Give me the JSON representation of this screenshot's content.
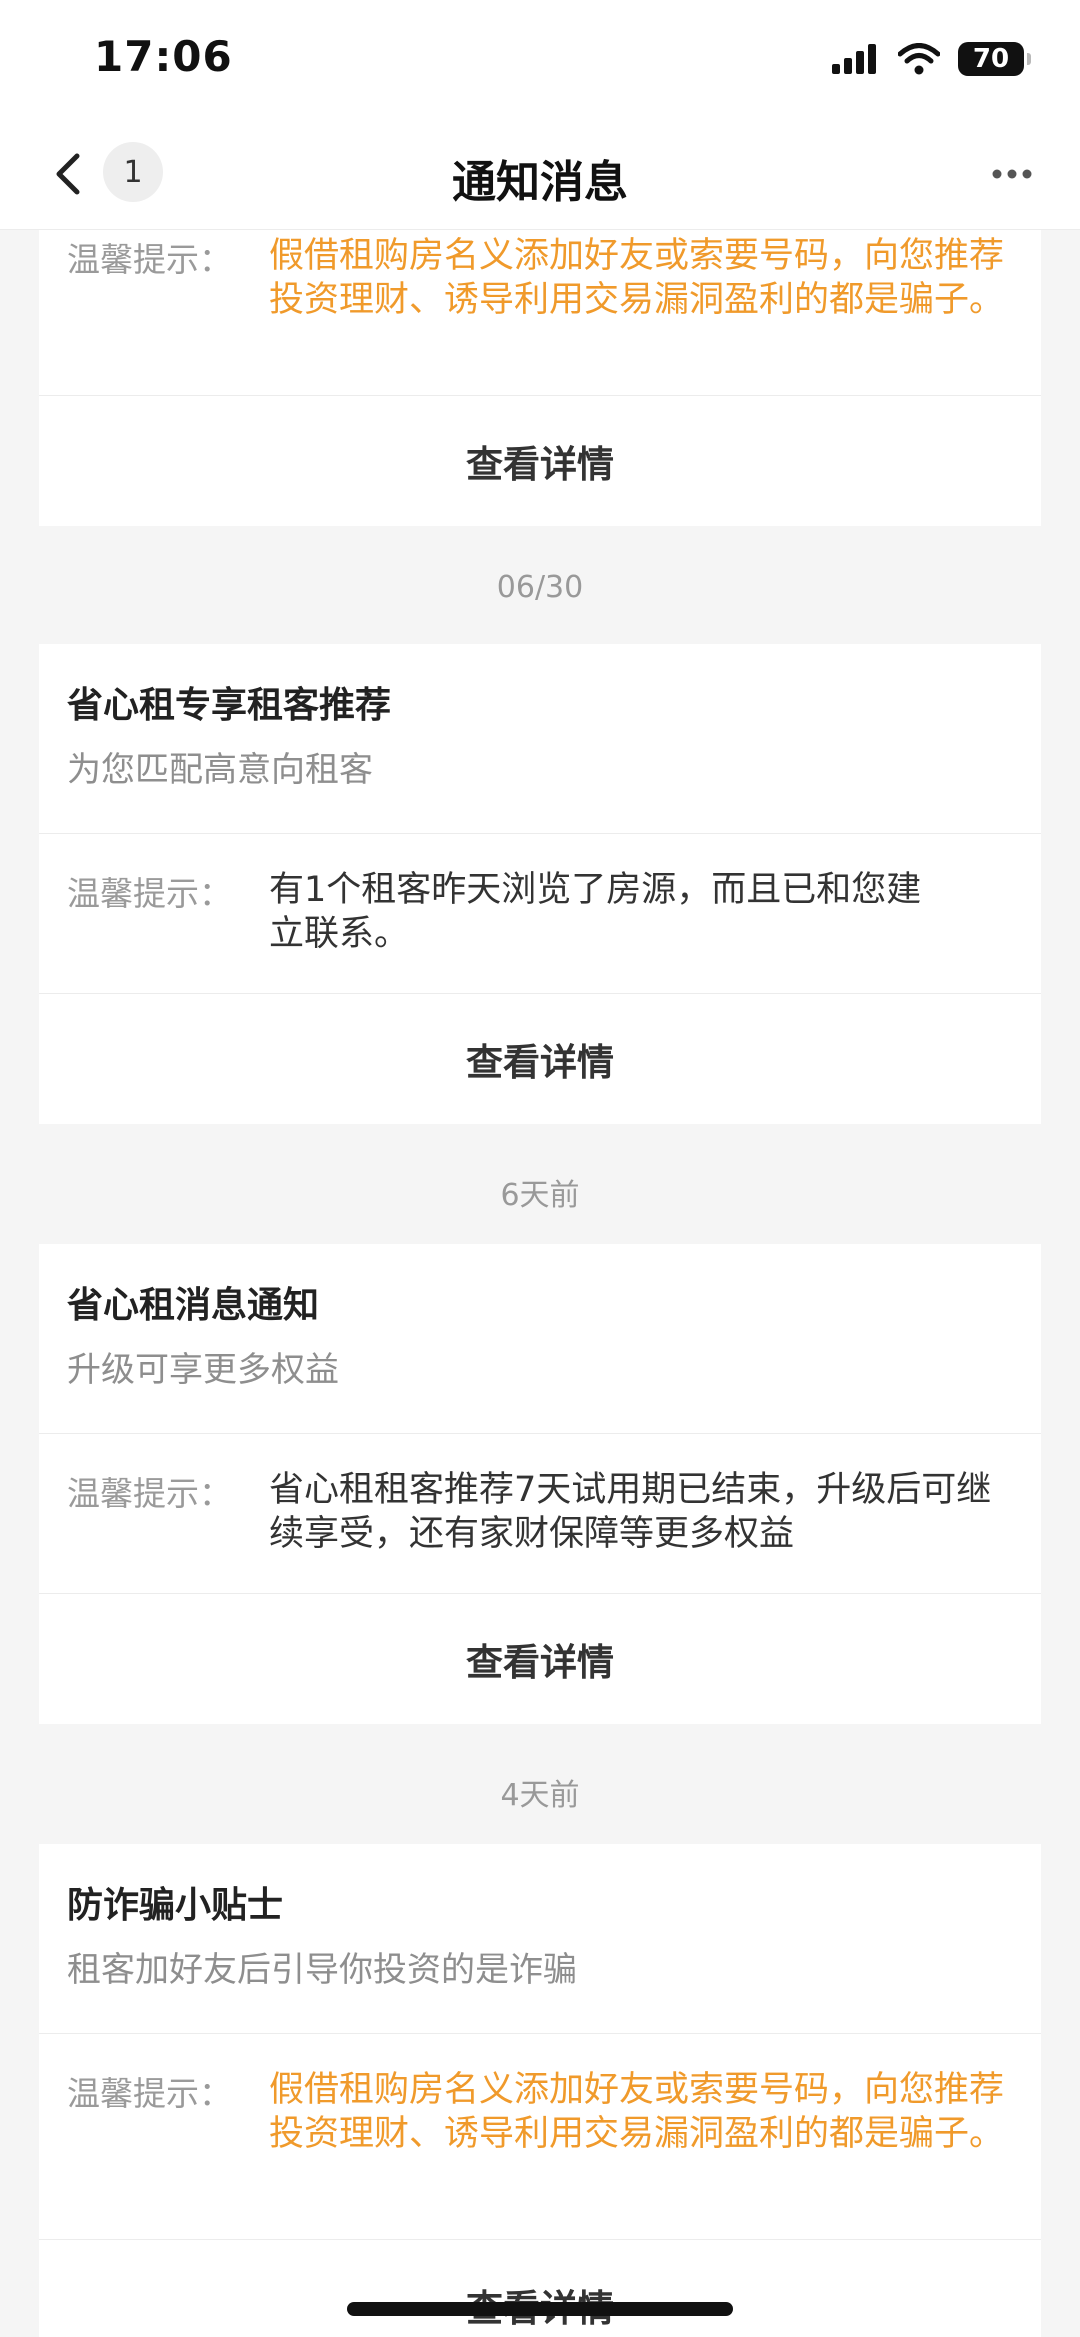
{
  "status": {
    "time": "17:06",
    "battery": "70"
  },
  "nav": {
    "badge": "1",
    "title": "通知消息"
  },
  "tip_label": "温馨提示：",
  "detail_label": "查看详情",
  "cards": [
    {
      "tip": "假借租购房名义添加好友或索要号码，向您推荐投资理财、诱导利用交易漏洞盈利的都是骗子。"
    },
    {
      "date": "06/30",
      "title": "省心租专享租客推荐",
      "subtitle": "为您匹配高意向租客",
      "tip": "有1个租客昨天浏览了房源，而且已和您建立联系。"
    },
    {
      "date": "6天前",
      "title": "省心租消息通知",
      "subtitle": "升级可享更多权益",
      "tip": "省心租租客推荐7天试用期已结束，升级后可继续享受，还有家财保障等更多权益"
    },
    {
      "date": "4天前",
      "title": "防诈骗小贴士",
      "subtitle": "租客加好友后引导你投资的是诈骗",
      "tip": "假借租购房名义添加好友或索要号码，向您推荐投资理财、诱导利用交易漏洞盈利的都是骗子。"
    }
  ],
  "colors": {
    "warning_text": "#f09a2b",
    "background": "#f5f5f5"
  }
}
